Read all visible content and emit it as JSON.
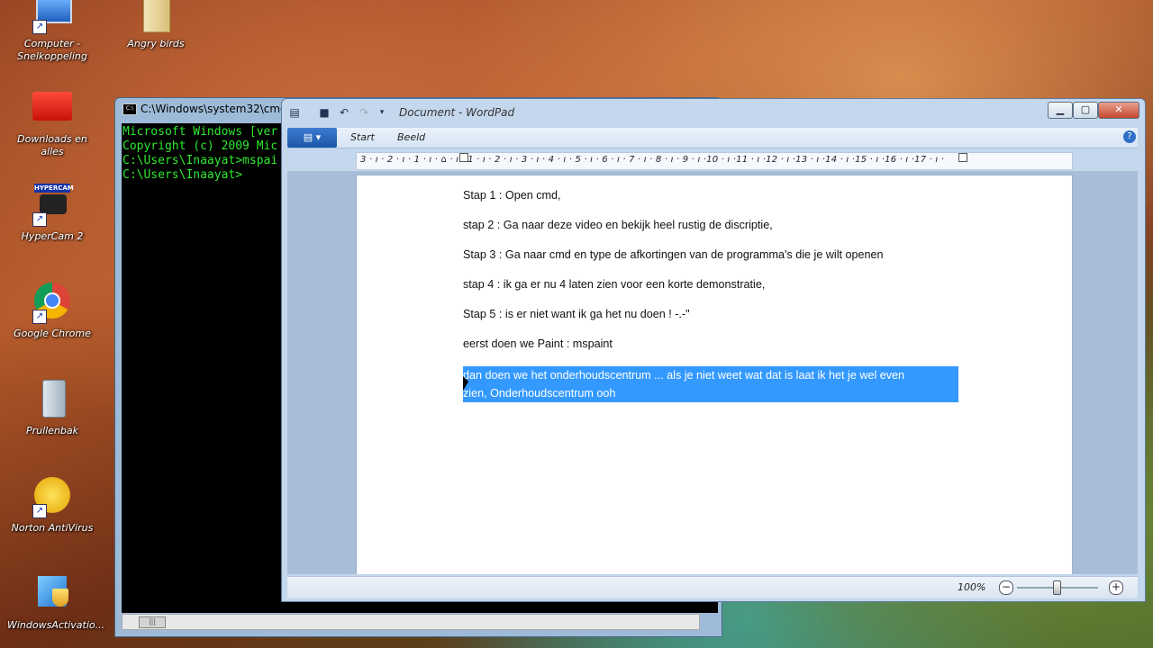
{
  "desktop": {
    "icons": [
      {
        "label": "Computer - Snelkoppeling",
        "icon": "computer-icon"
      },
      {
        "label": "Angry birds",
        "icon": "folder-icon"
      },
      {
        "label": "Downloads en alles",
        "icon": "folder-icon"
      },
      {
        "label": "HyperCam 2",
        "icon": "hypercam-icon"
      },
      {
        "label": "Google Chrome",
        "icon": "chrome-icon"
      },
      {
        "label": "Prullenbak",
        "icon": "recycle-bin-icon"
      },
      {
        "label": "Norton AntiVirus",
        "icon": "norton-icon"
      },
      {
        "label": "WindowsActivatio...",
        "icon": "windows-activation-icon"
      }
    ],
    "hypercam_badge": "HYPERCAM"
  },
  "cmd": {
    "title": "C:\\Windows\\system32\\cmd.ex",
    "lines": [
      "Microsoft Windows [ver",
      "Copyright (c) 2009 Mic",
      "",
      "C:\\Users\\Inaayat>mspai",
      "",
      "C:\\Users\\Inaayat>"
    ]
  },
  "wordpad": {
    "title": "Document - WordPad",
    "tabs": [
      "Start",
      "Beeld"
    ],
    "ruler": "3 · ı · 2 · ı · 1 · ı · ⌂ · ı · 1 · ı · 2 · ı · 3 · ı · 4 · ı · 5 · ı · 6 · ı · 7 · ı · 8 · ı · 9 · ı ·10 · ı ·11 · ı ·12 · ı ·13 · ı ·14 · ı ·15 · ı ·16 · ı ·17 · ı ·",
    "paragraphs": [
      "Stap 1 : Open cmd,",
      "stap 2 : Ga naar deze video en bekijk heel rustig de discriptie,",
      "Stap 3 : Ga naar cmd en type de afkortingen van de programma's die je wilt openen",
      "stap 4 : ik ga er nu 4 laten zien voor een korte demonstratie,",
      "Stap 5 : is er niet want ik ga het nu doen ! -.-\"",
      "eerst doen we Paint : mspaint"
    ],
    "selected_text_line1": "dan doen we het onderhoudscentrum ... als je niet weet wat dat is laat ik het je wel even",
    "selected_text_line2": "zien, Onderhoudscentrum ooh",
    "zoom": "100%"
  }
}
